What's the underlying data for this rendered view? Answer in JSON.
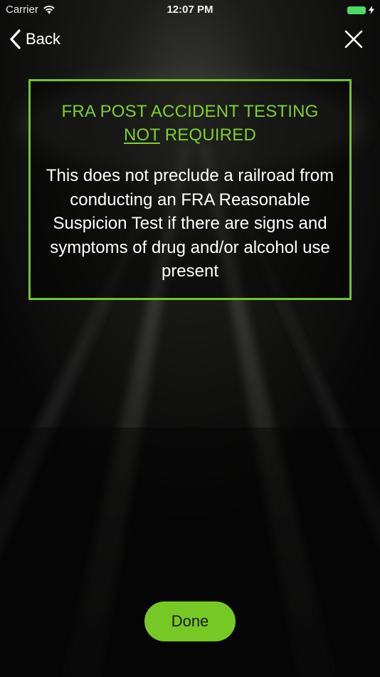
{
  "status_bar": {
    "carrier": "Carrier",
    "time": "12:07 PM",
    "wifi_icon": "wifi-icon",
    "battery_icon": "battery-icon",
    "battery_color": "#4cd964"
  },
  "nav": {
    "back_label": "Back",
    "back_icon": "chevron-left-icon",
    "close_icon": "close-icon"
  },
  "message": {
    "title_line1": "FRA POST ACCIDENT TESTING",
    "title_not": "NOT",
    "title_required": " REQUIRED",
    "body": "This does not preclude a railroad from conducting an FRA Reasonable Suspicion Test if there are signs and symptoms of drug and/or alcohol use present",
    "accent_color": "#71c52b"
  },
  "actions": {
    "done_label": "Done",
    "done_color": "#76c925"
  }
}
